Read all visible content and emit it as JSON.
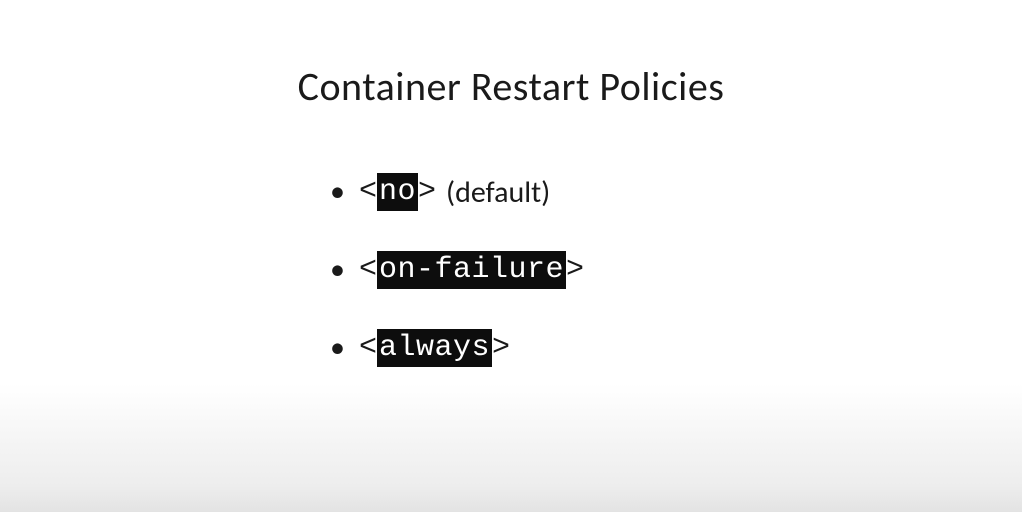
{
  "title": "Container Restart Policies",
  "angleOpen": "<",
  "angleClose": ">",
  "items": [
    {
      "code": "no",
      "suffix": "(default)"
    },
    {
      "code": "on-failure",
      "suffix": ""
    },
    {
      "code": "always",
      "suffix": ""
    }
  ]
}
